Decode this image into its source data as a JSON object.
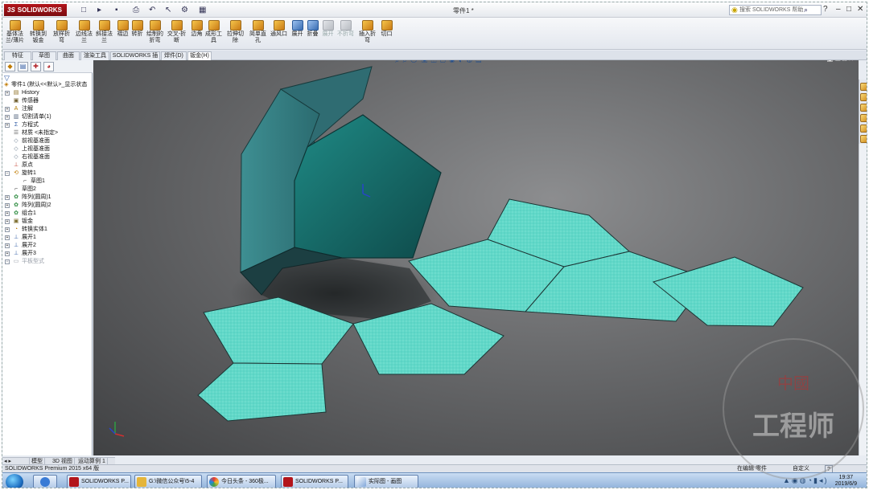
{
  "titlebar": {
    "logo_prefix": "3S",
    "logo_text": "SOLIDWORKS",
    "document": "零件1 *",
    "search_placeholder": "搜索 SOLIDWORKS 帮助",
    "quick_access": [
      "□",
      "▸",
      "▪",
      "⎙",
      "↶",
      "↖",
      "⚙",
      "▦"
    ]
  },
  "ribbon": {
    "buttons": [
      {
        "label": "基体法兰/薄片",
        "icon": "base-flange-icon"
      },
      {
        "label": "转换到钣金",
        "icon": "convert-sheetmetal-icon"
      },
      {
        "label": "放样折弯",
        "icon": "lofted-bend-icon"
      },
      {
        "label": "边线法兰",
        "icon": "edge-flange-icon"
      },
      {
        "label": "斜接法兰",
        "icon": "miter-flange-icon"
      },
      {
        "label": "褶边",
        "icon": "hem-icon"
      },
      {
        "label": "转折",
        "icon": "jog-icon"
      },
      {
        "label": "绘制的折弯",
        "icon": "sketched-bend-icon"
      },
      {
        "label": "交叉-折断",
        "icon": "cross-break-icon"
      },
      {
        "label": "边角",
        "icon": "corners-icon"
      },
      {
        "label": "成形工具",
        "icon": "forming-tool-icon"
      },
      {
        "label": "拉伸切除",
        "icon": "extruded-cut-icon"
      },
      {
        "label": "简单直孔",
        "icon": "simple-hole-icon"
      },
      {
        "label": "通风口",
        "icon": "vent-icon"
      },
      {
        "label": "展开",
        "icon": "unfold-icon"
      },
      {
        "label": "折叠",
        "icon": "fold-icon"
      },
      {
        "label": "展开",
        "icon": "flatten-icon"
      },
      {
        "label": "不折弯",
        "icon": "no-bends-icon"
      },
      {
        "label": "插入折弯",
        "icon": "insert-bends-icon"
      },
      {
        "label": "切口",
        "icon": "rip-icon"
      }
    ]
  },
  "tabs": [
    "特征",
    "草图",
    "曲面",
    "渲染工具",
    "SOLIDWORKS 插件",
    "焊件(D)",
    "钣金(H)"
  ],
  "feature_tree": {
    "root": "零件1 (默认<<默认>_显示状态",
    "items": [
      {
        "label": "History",
        "icon": "history-icon"
      },
      {
        "label": "传感器",
        "icon": "sensor-icon"
      },
      {
        "label": "注解",
        "icon": "annotation-icon"
      },
      {
        "label": "切割清单(1)",
        "icon": "cut-list-icon"
      },
      {
        "label": "方程式",
        "icon": "equation-icon"
      },
      {
        "label": "材质 <未指定>",
        "icon": "material-icon"
      },
      {
        "label": "前视基准面",
        "icon": "plane-icon"
      },
      {
        "label": "上视基准面",
        "icon": "plane-icon"
      },
      {
        "label": "右视基准面",
        "icon": "plane-icon"
      },
      {
        "label": "原点",
        "icon": "origin-icon"
      },
      {
        "label": "旋转1",
        "icon": "revolve-icon"
      },
      {
        "label": "草图1",
        "icon": "sketch-icon"
      },
      {
        "label": "草图2",
        "icon": "sketch-icon"
      },
      {
        "label": "阵列(圆周)1",
        "icon": "pattern-icon"
      },
      {
        "label": "阵列(圆周)2",
        "icon": "pattern-icon"
      },
      {
        "label": "组合1",
        "icon": "combine-icon"
      },
      {
        "label": "钣金",
        "icon": "sheetmetal-icon"
      },
      {
        "label": "转换实体1",
        "icon": "convert-icon"
      },
      {
        "label": "展开1",
        "icon": "flatten-feature-icon"
      },
      {
        "label": "展开2",
        "icon": "flatten-feature-icon"
      },
      {
        "label": "展开3",
        "icon": "flatten-feature-icon"
      },
      {
        "label": "平板型式",
        "icon": "flat-pattern-icon"
      }
    ]
  },
  "bottom_tabs": [
    "模型",
    "3D 视图",
    "运动算例 1"
  ],
  "status": {
    "left": "SOLIDWORKS Premium 2015 x64 版",
    "editing": "在编辑 零件",
    "units": "自定义",
    "help": "?"
  },
  "taskbar": {
    "items": [
      "",
      "SOLIDWORKS P...",
      "G:\\微信公众号\\5-4",
      "今日头条 - 360极...",
      "SOLIDWORKS P...",
      "实际图 - 画图"
    ],
    "time": "19:37",
    "date": "2019/6/9"
  },
  "watermark": {
    "top": "中國",
    "main": "工程师"
  },
  "colors": {
    "accent": "#b3151b",
    "model_teal": "#5fd6c4",
    "model_dark": "#165f5c"
  }
}
